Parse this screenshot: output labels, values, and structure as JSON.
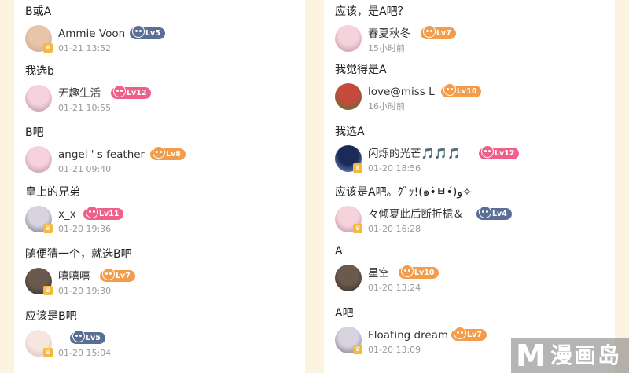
{
  "colors": {
    "page_background": "#fdf3e1",
    "card_background": "#ffffff",
    "level_blue": "#5b6f95",
    "level_orange": "#f39c4a",
    "level_pink": "#ef5f8a",
    "vip_badge": "#f6b93b"
  },
  "left_column": {
    "comments": [
      {
        "text": "B或A",
        "username": "Ammie Voon",
        "level": "Lv5",
        "level_tier": "blue",
        "timestamp": "01-21 13:52",
        "avatar_icon": "baby-avatar",
        "vip": true
      },
      {
        "text": "我选b",
        "username": "无趣生活",
        "level": "Lv12",
        "level_tier": "pink",
        "timestamp": "01-21 10:55",
        "avatar_icon": "anime-girl-avatar",
        "vip": false
      },
      {
        "text": "B吧",
        "username": "angel ' s feather",
        "level": "Lv8",
        "level_tier": "orange",
        "timestamp": "01-21 09:40",
        "avatar_icon": "anime-girl-avatar",
        "vip": false
      },
      {
        "text": "皇上的兄弟",
        "username": "x_x",
        "level": "Lv11",
        "level_tier": "pink",
        "timestamp": "01-20 19:36",
        "avatar_icon": "anime-character-avatar",
        "vip": true
      },
      {
        "text": "随便猜一个，就选B吧",
        "username": "嘻嘻嘻",
        "level": "Lv7",
        "level_tier": "orange",
        "timestamp": "01-20 19:30",
        "avatar_icon": "photo-avatar",
        "vip": true
      },
      {
        "text": "应该是B吧",
        "username": "",
        "level": "Lv5",
        "level_tier": "blue",
        "timestamp": "01-20 15:04",
        "avatar_icon": "cute-cat-avatar",
        "vip": true
      }
    ]
  },
  "right_column": {
    "comments": [
      {
        "text": "应该，是A吧？",
        "username": "春夏秋冬",
        "level": "Lv7",
        "level_tier": "orange",
        "timestamp": "15小时前",
        "avatar_icon": "anime-girl-avatar",
        "vip": false
      },
      {
        "text": "我觉得是A",
        "username": "love@miss  L",
        "level": "Lv10",
        "level_tier": "orange",
        "timestamp": "16小时前",
        "avatar_icon": "flower-avatar",
        "vip": false
      },
      {
        "text": "我选A",
        "username": "闪烁的光芒🎵🎵🎵",
        "level": "Lv12",
        "level_tier": "pink",
        "timestamp": "01-20 18:56",
        "avatar_icon": "galaxy-avatar",
        "vip": true
      },
      {
        "text": "应该是A吧。ｸﾞｯ!(๑•̀ㅂ•́)و✧",
        "username": "々倾夏此后断折栀＆",
        "level": "Lv4",
        "level_tier": "blue",
        "timestamp": "01-20 16:28",
        "avatar_icon": "anime-girl-avatar",
        "vip": true
      },
      {
        "text": "A",
        "username": "星空",
        "level": "Lv10",
        "level_tier": "orange",
        "timestamp": "01-20 13:24",
        "avatar_icon": "photo-avatar",
        "vip": false
      },
      {
        "text": "A吧",
        "username": "Floating dream",
        "level": "Lv7",
        "level_tier": "orange",
        "timestamp": "01-20 13:09",
        "avatar_icon": "anime-character-avatar",
        "vip": true
      }
    ]
  },
  "watermark": {
    "letter": "M",
    "text": "漫画岛"
  }
}
